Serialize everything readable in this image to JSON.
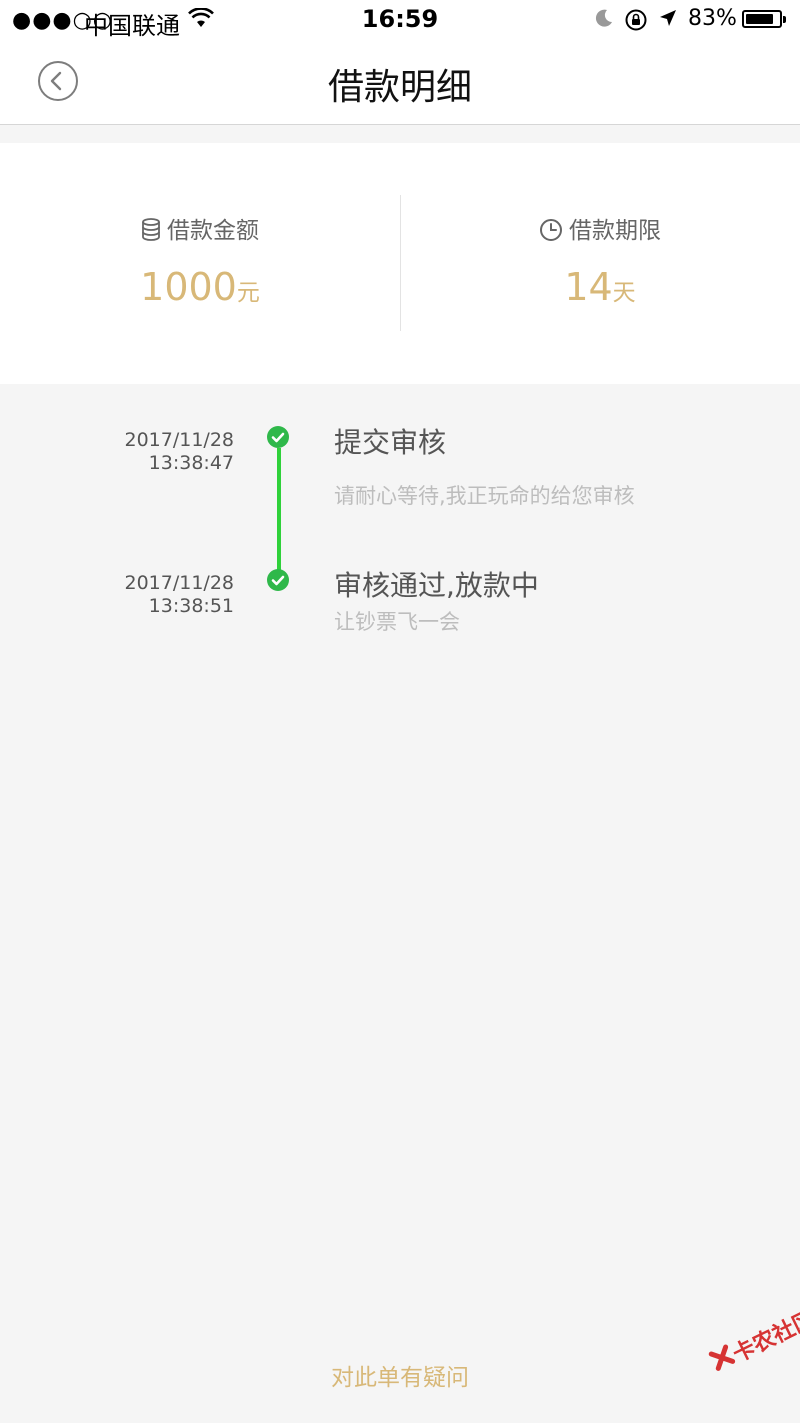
{
  "status_bar": {
    "signal": "●●●○○",
    "carrier": "中国联通",
    "time": "16:59",
    "battery_percent": "83%",
    "battery_level": 0.83
  },
  "nav": {
    "title": "借款明细",
    "back_icon": "chevron-left-circle-icon"
  },
  "summary": {
    "amount": {
      "label": "借款金额",
      "value": "1000",
      "unit": "元",
      "icon": "coin-stack-icon"
    },
    "term": {
      "label": "借款期限",
      "value": "14",
      "unit": "天",
      "icon": "clock-icon"
    }
  },
  "timeline": [
    {
      "date": "2017/11/28",
      "time": "13:38:47",
      "title": "提交审核",
      "subtitle": "请耐心等待,我正玩命的给您审核",
      "status_icon": "check-circle-icon"
    },
    {
      "date": "2017/11/28",
      "time": "13:38:51",
      "title": "审核通过,放款中",
      "subtitle": "让钞票飞一会",
      "status_icon": "check-circle-icon"
    }
  ],
  "footer": {
    "question_link": "对此单有疑问"
  },
  "watermark": {
    "text": "卡农社区"
  },
  "colors": {
    "accent_gold": "#d8b878",
    "success_green": "#2fb84a",
    "line_green": "#2fd13a"
  }
}
